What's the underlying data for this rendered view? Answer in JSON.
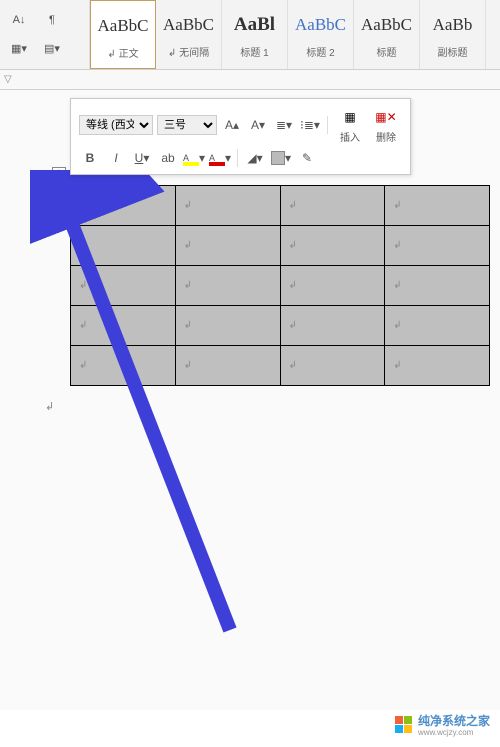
{
  "ribbon": {
    "styles": [
      {
        "preview": "AaBbC",
        "label": "↲ 正文",
        "cls": "",
        "selected": true
      },
      {
        "preview": "AaBbC",
        "label": "↲ 无间隔",
        "cls": "",
        "selected": false
      },
      {
        "preview": "AaBl",
        "label": "标题 1",
        "cls": "bold",
        "selected": false
      },
      {
        "preview": "AaBbC",
        "label": "标题 2",
        "cls": "blue",
        "selected": false
      },
      {
        "preview": "AaBbC",
        "label": "标题",
        "cls": "",
        "selected": false
      },
      {
        "preview": "AaBb",
        "label": "副标题",
        "cls": "",
        "selected": false
      }
    ]
  },
  "mini_toolbar": {
    "font_name": "等线 (西文",
    "font_size": "三号",
    "insert_label": "插入",
    "delete_label": "删除",
    "bold": "B",
    "italic": "I",
    "underline": "U"
  },
  "table": {
    "rows": 5,
    "cols": 4,
    "cell_mark": "↲"
  },
  "para_mark": "↲",
  "watermark": {
    "title": "纯净系统之家",
    "url": "www.wcjzy.com"
  }
}
